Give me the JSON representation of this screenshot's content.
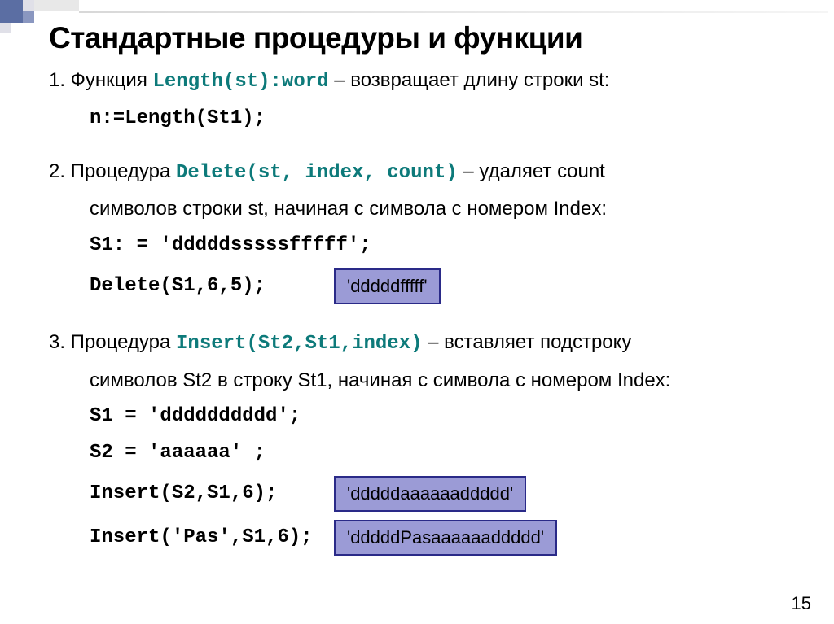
{
  "title": "Стандартные процедуры и функции",
  "item1": {
    "lead": "1. Функция ",
    "code": "Length(st):word",
    "tail": " – возвращает длину строки st:",
    "example": "n:=Length(St1);"
  },
  "item2": {
    "lead": "2. Процедура ",
    "code": "Delete(st, index, count)",
    "tail": " – удаляет count",
    "cont": "символов строки st, начиная с символа с номером Index:",
    "ex1": "S1: = 'dddddsssssfffff';",
    "ex2": "Delete(S1,6,5);",
    "box": "'dddddfffff'"
  },
  "item3": {
    "lead": "3. Процедура ",
    "code": "Insert(St2,St1,index)",
    "tail": " – вставляет подстроку",
    "cont": "символов St2 в строку St1, начиная с символа с номером Index:",
    "ex1": "S1 = 'dddddddddd';",
    "ex2": "S2 = 'aaaaaa' ;",
    "ex3": "Insert(S2,S1,6);",
    "ex4": "Insert('Pas',S1,6);",
    "box1": "'dddddaaaaaaddddd'",
    "box2": "'dddddPasaaaaaaddddd'"
  },
  "pagenum": "15"
}
